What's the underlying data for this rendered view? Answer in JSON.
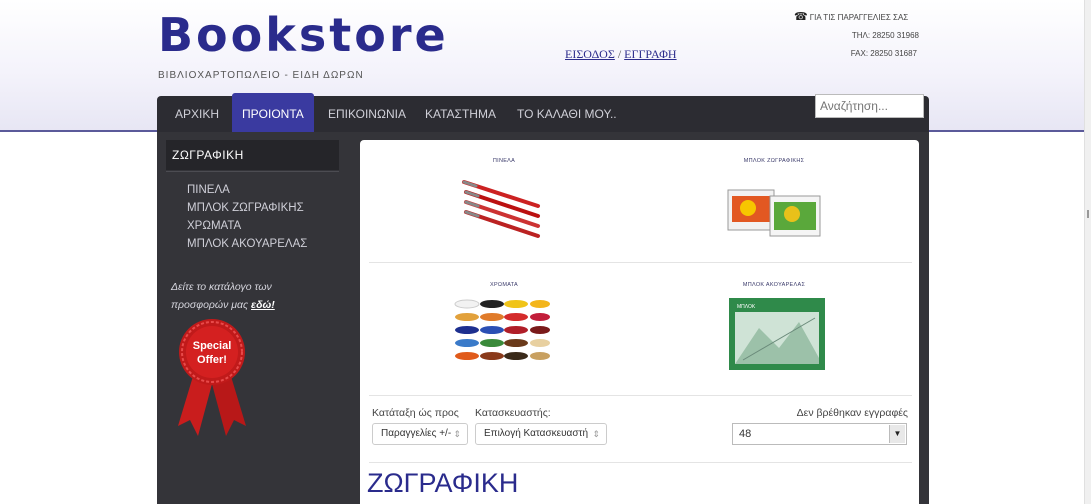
{
  "header": {
    "logo": "Bookstore",
    "tagline": "ΒΙΒΛΙΟΧΑΡΤΟΠΩΛΕΙΟ - ΕΙΔΗ ΔΩΡΩΝ",
    "login": "ΕΙΣΟΔΟΣ",
    "separator": "/",
    "register": "ΕΓΓΡΑΦΗ",
    "contact": {
      "title": "ΓΙΑ ΤΙΣ ΠΑΡΑΓΓΕΛΙΕΣ ΣΑΣ",
      "phone": "ΤΗΛ: 28250 31968",
      "fax": "FAX: 28250 31687"
    }
  },
  "nav": {
    "items": [
      {
        "label": "ΑΡΧΙΚΗ"
      },
      {
        "label": "ΠΡΟΙΟΝΤΑ"
      },
      {
        "label": "ΕΠΙΚΟΙΝΩΝΙΑ"
      },
      {
        "label": "ΚΑΤΑΣΤΗΜΑ"
      },
      {
        "label": "ΤΟ ΚΑΛΑΘΙ ΜΟΥ.."
      }
    ],
    "active": "ΠΡΟΙΟΝΤΑ",
    "search_placeholder": "Αναζήτηση..."
  },
  "sidebar": {
    "heading": "ΖΩΓΡΑΦΙΚΗ",
    "links": [
      "ΠΙΝΕΛΑ",
      "ΜΠΛΟΚ ΖΩΓΡΑΦΙΚΗΣ",
      "ΧΡΩΜΑΤΑ",
      "ΜΠΛΟΚ ΑΚΟΥΑΡΕΛΑΣ"
    ],
    "promo_text_line1": "Δείτε το κατάλογο των",
    "promo_text_line2": "προσφορών μας",
    "promo_link": "εδώ!",
    "badge_line1": "Special",
    "badge_line2": "Offer!"
  },
  "categories": [
    {
      "title": "ΠΙΝΕΛΑ",
      "icon": "brushes-image"
    },
    {
      "title": "ΜΠΛΟΚ ΖΩΓΡΑΦΙΚΗΣ",
      "icon": "drawing-pad-image"
    },
    {
      "title": "ΧΡΩΜΑΤΑ",
      "icon": "paints-image"
    },
    {
      "title": "ΜΠΛΟΚ ΑΚΟΥΑΡΕΛΑΣ",
      "icon": "watercolor-pad-image"
    }
  ],
  "toolbar": {
    "sort_label": "Κατάταξη ώς προς",
    "sort_value": "Παραγγελίες +/-",
    "manufacturer_label": "Κατασκευαστής:",
    "manufacturer_value": "Επιλογή Κατασκευαστή",
    "no_results": "Δεν βρέθηκαν εγγραφές",
    "per_page": "48"
  },
  "page_heading": "ΖΩΓΡΑΦΙΚΗ",
  "colors": {
    "brand": "#2a2b8c",
    "nav_bg": "#2c2c32",
    "nav_active": "#3a3aa0",
    "badge_red": "#d42020"
  }
}
